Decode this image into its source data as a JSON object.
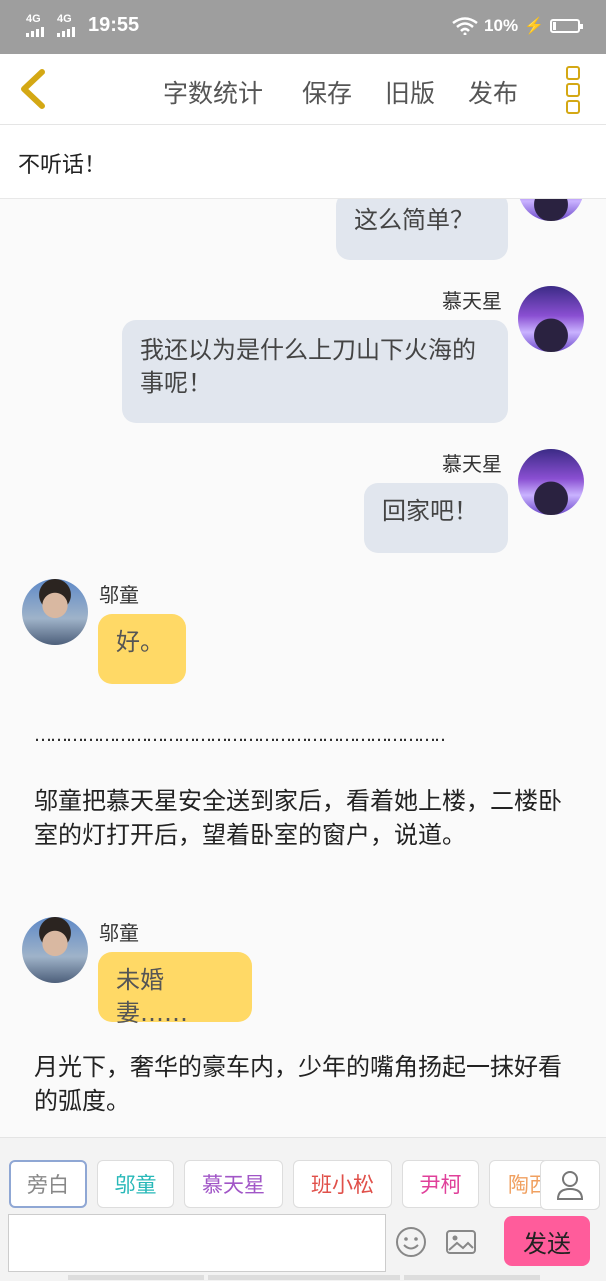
{
  "status": {
    "net1": "4G",
    "net2": "4G",
    "time": "19:55",
    "battery": "10%"
  },
  "toolbar": {
    "word_count": "字数统计",
    "save": "保存",
    "old": "旧版",
    "publish": "发布"
  },
  "story": {
    "title": "不听话！"
  },
  "messages": [
    {
      "side": "right",
      "name": "",
      "text": "这么简单？"
    },
    {
      "side": "right",
      "name": "慕天星",
      "text": "我还以为是什么上刀山下火海的事呢！"
    },
    {
      "side": "right",
      "name": "慕天星",
      "text": "回家吧！"
    },
    {
      "side": "left",
      "name": "邬童",
      "text": "好。"
    },
    {
      "divider": "……………………………………………………………………"
    },
    {
      "narration": "邬童把慕天星安全送到家后，看着她上楼，二楼卧室的灯打开后，望着卧室的窗户，说道。"
    },
    {
      "side": "left",
      "name": "邬童",
      "text": "未婚妻……"
    },
    {
      "narration": "月光下，奢华的豪车内，少年的嘴角扬起一抹好看的弧度。"
    }
  ],
  "roles": [
    {
      "label": "旁白",
      "color": "#888888"
    },
    {
      "label": "邬童",
      "color": "#27b8b8"
    },
    {
      "label": "慕天星",
      "color": "#a156c7"
    },
    {
      "label": "班小松",
      "color": "#e0504a"
    },
    {
      "label": "尹柯",
      "color": "#e0409a"
    },
    {
      "label": "陶西",
      "color": "#f0a060"
    }
  ],
  "composer": {
    "send": "发送",
    "placeholder": ""
  },
  "colors": {
    "accent": "#ff5c9b",
    "left_bubble": "#ffd966",
    "right_bubble": "#e1e6ee",
    "icon": "#d4a814"
  }
}
